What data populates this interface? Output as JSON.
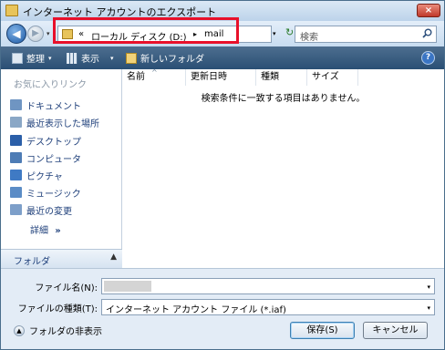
{
  "window": {
    "title": "インターネット アカウントのエクスポート",
    "close_glyph": "×"
  },
  "address": {
    "chevron": "«",
    "segments": [
      "ローカル ディスク (D:)",
      "mail"
    ],
    "separator": "▸",
    "dropdown_glyph": "▾"
  },
  "nav": {
    "back_glyph": "◀",
    "forward_glyph": "▶",
    "refresh_glyph": "↻"
  },
  "search": {
    "placeholder": "検索",
    "icon": "search-icon"
  },
  "toolbar": {
    "organize_label": "整理",
    "view_label": "表示",
    "new_folder_label": "新しいフォルダ",
    "help_glyph": "?",
    "drop_glyph": "▾"
  },
  "sidebar": {
    "heading": "お気に入りリンク",
    "items": [
      {
        "label": "ドキュメント",
        "icon": "documents-icon"
      },
      {
        "label": "最近表示した場所",
        "icon": "recent-places-icon"
      },
      {
        "label": "デスクトップ",
        "icon": "desktop-icon"
      },
      {
        "label": "コンピュータ",
        "icon": "computer-icon"
      },
      {
        "label": "ピクチャ",
        "icon": "pictures-icon"
      },
      {
        "label": "ミュージック",
        "icon": "music-icon"
      },
      {
        "label": "最近の変更",
        "icon": "recently-changed-icon"
      }
    ],
    "details_label": "詳細",
    "details_glyph": "»",
    "folders_label": "フォルダ",
    "folders_glyph": "▲"
  },
  "filelist": {
    "columns": [
      "名前",
      "更新日時",
      "種類",
      "サイズ"
    ],
    "sort_glyph": "^",
    "empty_message": "検索条件に一致する項目はありません。"
  },
  "bottom": {
    "filename_label": "ファイル名(N):",
    "filename_value": "",
    "filetype_label": "ファイルの種類(T):",
    "filetype_value": "インターネット アカウント ファイル (*.iaf)",
    "hide_folders_label": "フォルダの非表示",
    "hide_glyph": "▲",
    "save_label": "保存(S)",
    "cancel_label": "キャンセル",
    "dropdown_glyph": "▾"
  },
  "colors": {
    "highlight_box": "#e8102a",
    "toolbar": "#2a4f74",
    "link_text": "#1e3f7a"
  }
}
